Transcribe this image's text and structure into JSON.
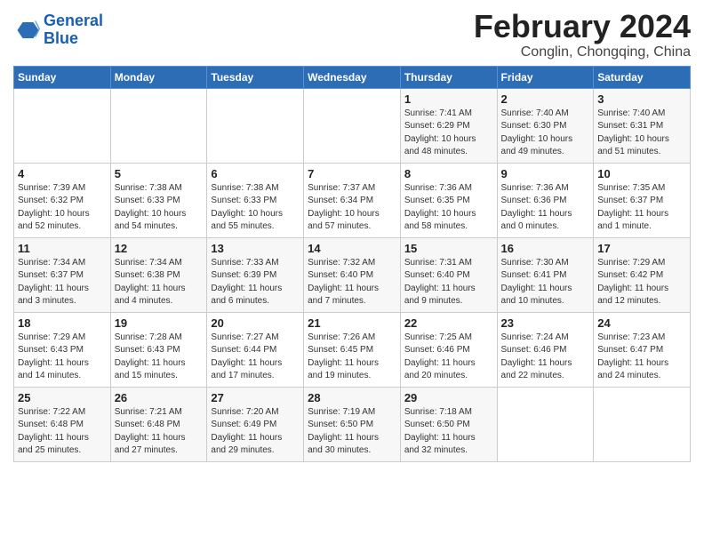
{
  "logo": {
    "line1": "General",
    "line2": "Blue"
  },
  "title": "February 2024",
  "subtitle": "Conglin, Chongqing, China",
  "headers": [
    "Sunday",
    "Monday",
    "Tuesday",
    "Wednesday",
    "Thursday",
    "Friday",
    "Saturday"
  ],
  "weeks": [
    [
      {
        "day": "",
        "info": ""
      },
      {
        "day": "",
        "info": ""
      },
      {
        "day": "",
        "info": ""
      },
      {
        "day": "",
        "info": ""
      },
      {
        "day": "1",
        "info": "Sunrise: 7:41 AM\nSunset: 6:29 PM\nDaylight: 10 hours\nand 48 minutes."
      },
      {
        "day": "2",
        "info": "Sunrise: 7:40 AM\nSunset: 6:30 PM\nDaylight: 10 hours\nand 49 minutes."
      },
      {
        "day": "3",
        "info": "Sunrise: 7:40 AM\nSunset: 6:31 PM\nDaylight: 10 hours\nand 51 minutes."
      }
    ],
    [
      {
        "day": "4",
        "info": "Sunrise: 7:39 AM\nSunset: 6:32 PM\nDaylight: 10 hours\nand 52 minutes."
      },
      {
        "day": "5",
        "info": "Sunrise: 7:38 AM\nSunset: 6:33 PM\nDaylight: 10 hours\nand 54 minutes."
      },
      {
        "day": "6",
        "info": "Sunrise: 7:38 AM\nSunset: 6:33 PM\nDaylight: 10 hours\nand 55 minutes."
      },
      {
        "day": "7",
        "info": "Sunrise: 7:37 AM\nSunset: 6:34 PM\nDaylight: 10 hours\nand 57 minutes."
      },
      {
        "day": "8",
        "info": "Sunrise: 7:36 AM\nSunset: 6:35 PM\nDaylight: 10 hours\nand 58 minutes."
      },
      {
        "day": "9",
        "info": "Sunrise: 7:36 AM\nSunset: 6:36 PM\nDaylight: 11 hours\nand 0 minutes."
      },
      {
        "day": "10",
        "info": "Sunrise: 7:35 AM\nSunset: 6:37 PM\nDaylight: 11 hours\nand 1 minute."
      }
    ],
    [
      {
        "day": "11",
        "info": "Sunrise: 7:34 AM\nSunset: 6:37 PM\nDaylight: 11 hours\nand 3 minutes."
      },
      {
        "day": "12",
        "info": "Sunrise: 7:34 AM\nSunset: 6:38 PM\nDaylight: 11 hours\nand 4 minutes."
      },
      {
        "day": "13",
        "info": "Sunrise: 7:33 AM\nSunset: 6:39 PM\nDaylight: 11 hours\nand 6 minutes."
      },
      {
        "day": "14",
        "info": "Sunrise: 7:32 AM\nSunset: 6:40 PM\nDaylight: 11 hours\nand 7 minutes."
      },
      {
        "day": "15",
        "info": "Sunrise: 7:31 AM\nSunset: 6:40 PM\nDaylight: 11 hours\nand 9 minutes."
      },
      {
        "day": "16",
        "info": "Sunrise: 7:30 AM\nSunset: 6:41 PM\nDaylight: 11 hours\nand 10 minutes."
      },
      {
        "day": "17",
        "info": "Sunrise: 7:29 AM\nSunset: 6:42 PM\nDaylight: 11 hours\nand 12 minutes."
      }
    ],
    [
      {
        "day": "18",
        "info": "Sunrise: 7:29 AM\nSunset: 6:43 PM\nDaylight: 11 hours\nand 14 minutes."
      },
      {
        "day": "19",
        "info": "Sunrise: 7:28 AM\nSunset: 6:43 PM\nDaylight: 11 hours\nand 15 minutes."
      },
      {
        "day": "20",
        "info": "Sunrise: 7:27 AM\nSunset: 6:44 PM\nDaylight: 11 hours\nand 17 minutes."
      },
      {
        "day": "21",
        "info": "Sunrise: 7:26 AM\nSunset: 6:45 PM\nDaylight: 11 hours\nand 19 minutes."
      },
      {
        "day": "22",
        "info": "Sunrise: 7:25 AM\nSunset: 6:46 PM\nDaylight: 11 hours\nand 20 minutes."
      },
      {
        "day": "23",
        "info": "Sunrise: 7:24 AM\nSunset: 6:46 PM\nDaylight: 11 hours\nand 22 minutes."
      },
      {
        "day": "24",
        "info": "Sunrise: 7:23 AM\nSunset: 6:47 PM\nDaylight: 11 hours\nand 24 minutes."
      }
    ],
    [
      {
        "day": "25",
        "info": "Sunrise: 7:22 AM\nSunset: 6:48 PM\nDaylight: 11 hours\nand 25 minutes."
      },
      {
        "day": "26",
        "info": "Sunrise: 7:21 AM\nSunset: 6:48 PM\nDaylight: 11 hours\nand 27 minutes."
      },
      {
        "day": "27",
        "info": "Sunrise: 7:20 AM\nSunset: 6:49 PM\nDaylight: 11 hours\nand 29 minutes."
      },
      {
        "day": "28",
        "info": "Sunrise: 7:19 AM\nSunset: 6:50 PM\nDaylight: 11 hours\nand 30 minutes."
      },
      {
        "day": "29",
        "info": "Sunrise: 7:18 AM\nSunset: 6:50 PM\nDaylight: 11 hours\nand 32 minutes."
      },
      {
        "day": "",
        "info": ""
      },
      {
        "day": "",
        "info": ""
      }
    ]
  ]
}
